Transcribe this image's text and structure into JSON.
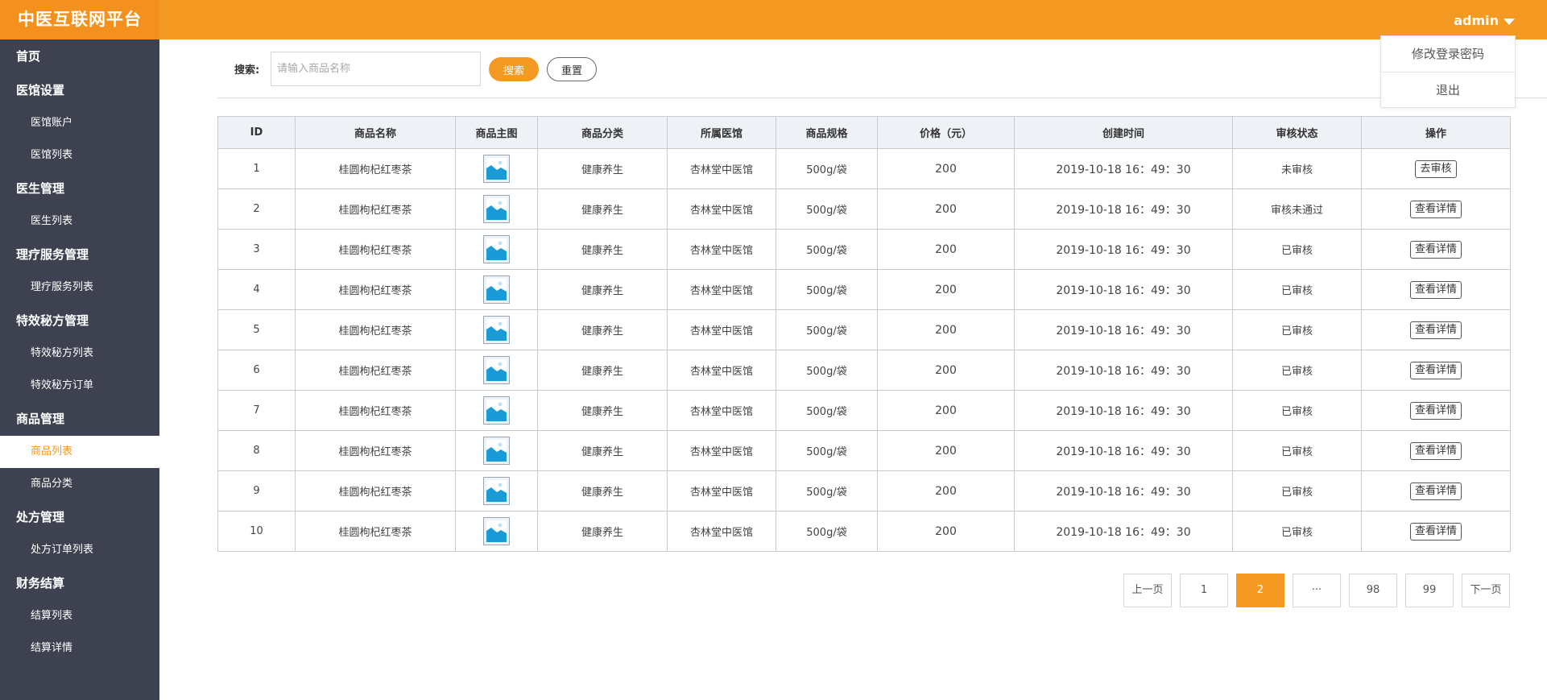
{
  "app": {
    "title": "中医互联网平台"
  },
  "user": {
    "name": "admin",
    "menu": [
      "修改登录密码",
      "退出"
    ]
  },
  "sidebar": {
    "groups": [
      {
        "label": "首页",
        "items": []
      },
      {
        "label": "医馆设置",
        "items": [
          "医馆账户",
          "医馆列表"
        ]
      },
      {
        "label": "医生管理",
        "items": [
          "医生列表"
        ]
      },
      {
        "label": "理疗服务管理",
        "items": [
          "理疗服务列表"
        ]
      },
      {
        "label": "特效秘方管理",
        "items": [
          "特效秘方列表",
          "特效秘方订单"
        ]
      },
      {
        "label": "商品管理",
        "items": [
          "商品列表",
          "商品分类"
        ]
      },
      {
        "label": "处方管理",
        "items": [
          "处方订单列表"
        ]
      },
      {
        "label": "财务结算",
        "items": [
          "结算列表",
          "结算详情"
        ]
      }
    ],
    "active_item": "商品列表"
  },
  "search": {
    "label": "搜索:",
    "placeholder": "请输入商品名称",
    "value": "",
    "search_button": "搜索",
    "reset_button": "重置"
  },
  "table": {
    "columns": [
      "ID",
      "商品名称",
      "商品主图",
      "商品分类",
      "所属医馆",
      "商品规格",
      "价格（元）",
      "创建时间",
      "审核状态",
      "操作"
    ],
    "rows": [
      {
        "id": "1",
        "name": "桂圆枸杞红枣茶",
        "category": "健康养生",
        "clinic": "杏林堂中医馆",
        "spec": "500g/袋",
        "price": "200",
        "created": "2019-10-18  16：49：30",
        "status": "未审核",
        "status_color": "#f49a23",
        "action": "去审核"
      },
      {
        "id": "2",
        "name": "桂圆枸杞红枣茶",
        "category": "健康养生",
        "clinic": "杏林堂中医馆",
        "spec": "500g/袋",
        "price": "200",
        "created": "2019-10-18  16：49：30",
        "status": "审核未通过",
        "status_color": "#e0263a",
        "action": "查看详情"
      },
      {
        "id": "3",
        "name": "桂圆枸杞红枣茶",
        "category": "健康养生",
        "clinic": "杏林堂中医馆",
        "spec": "500g/袋",
        "price": "200",
        "created": "2019-10-18  16：49：30",
        "status": "已审核",
        "status_color": "#2aa515",
        "action": "查看详情"
      },
      {
        "id": "4",
        "name": "桂圆枸杞红枣茶",
        "category": "健康养生",
        "clinic": "杏林堂中医馆",
        "spec": "500g/袋",
        "price": "200",
        "created": "2019-10-18  16：49：30",
        "status": "已审核",
        "status_color": "#2aa515",
        "action": "查看详情"
      },
      {
        "id": "5",
        "name": "桂圆枸杞红枣茶",
        "category": "健康养生",
        "clinic": "杏林堂中医馆",
        "spec": "500g/袋",
        "price": "200",
        "created": "2019-10-18  16：49：30",
        "status": "已审核",
        "status_color": "#2aa515",
        "action": "查看详情"
      },
      {
        "id": "6",
        "name": "桂圆枸杞红枣茶",
        "category": "健康养生",
        "clinic": "杏林堂中医馆",
        "spec": "500g/袋",
        "price": "200",
        "created": "2019-10-18  16：49：30",
        "status": "已审核",
        "status_color": "#2aa515",
        "action": "查看详情"
      },
      {
        "id": "7",
        "name": "桂圆枸杞红枣茶",
        "category": "健康养生",
        "clinic": "杏林堂中医馆",
        "spec": "500g/袋",
        "price": "200",
        "created": "2019-10-18  16：49：30",
        "status": "已审核",
        "status_color": "#2aa515",
        "action": "查看详情"
      },
      {
        "id": "8",
        "name": "桂圆枸杞红枣茶",
        "category": "健康养生",
        "clinic": "杏林堂中医馆",
        "spec": "500g/袋",
        "price": "200",
        "created": "2019-10-18  16：49：30",
        "status": "已审核",
        "status_color": "#2aa515",
        "action": "查看详情"
      },
      {
        "id": "9",
        "name": "桂圆枸杞红枣茶",
        "category": "健康养生",
        "clinic": "杏林堂中医馆",
        "spec": "500g/袋",
        "price": "200",
        "created": "2019-10-18  16：49：30",
        "status": "已审核",
        "status_color": "#2aa515",
        "action": "查看详情"
      },
      {
        "id": "10",
        "name": "桂圆枸杞红枣茶",
        "category": "健康养生",
        "clinic": "杏林堂中医馆",
        "spec": "500g/袋",
        "price": "200",
        "created": "2019-10-18  16：49：30",
        "status": "已审核",
        "status_color": "#2aa515",
        "action": "查看详情"
      }
    ],
    "image_icon": "image-placeholder-icon"
  },
  "pagination": {
    "prev": "上一页",
    "pages": [
      "1",
      "2",
      "···",
      "98",
      "99"
    ],
    "current": "2",
    "next": "下一页"
  },
  "colors": {
    "accent": "#f49a23",
    "sidebar_bg": "#3e4250",
    "status_pending": "#f49a23",
    "status_rejected": "#e0263a",
    "status_approved": "#2aa515"
  }
}
